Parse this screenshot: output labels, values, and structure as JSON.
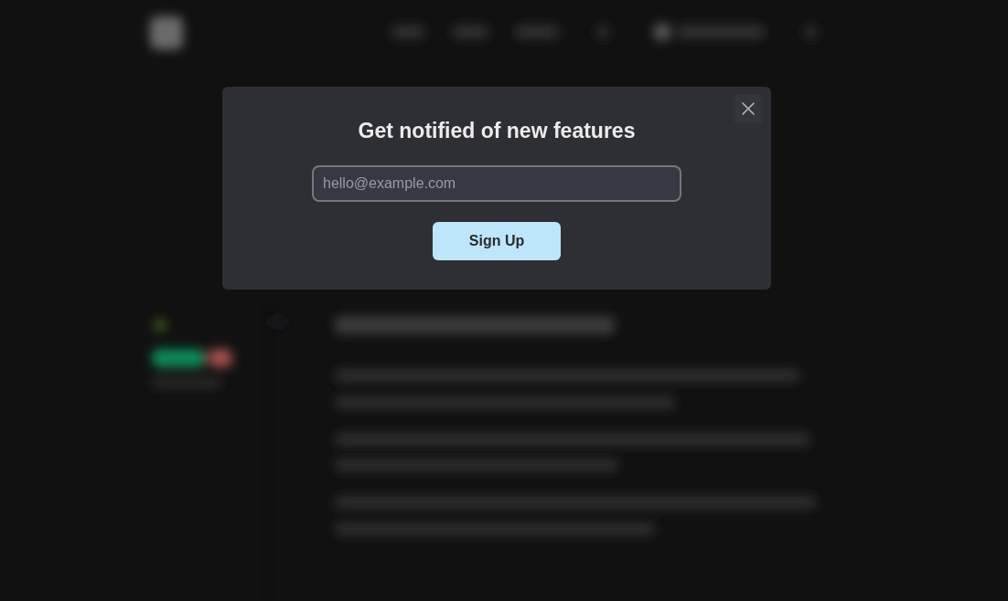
{
  "dialog": {
    "title": "Get notified of new features",
    "email_field": {
      "placeholder": "hello@example.com"
    },
    "submit_button": "Sign Up"
  }
}
